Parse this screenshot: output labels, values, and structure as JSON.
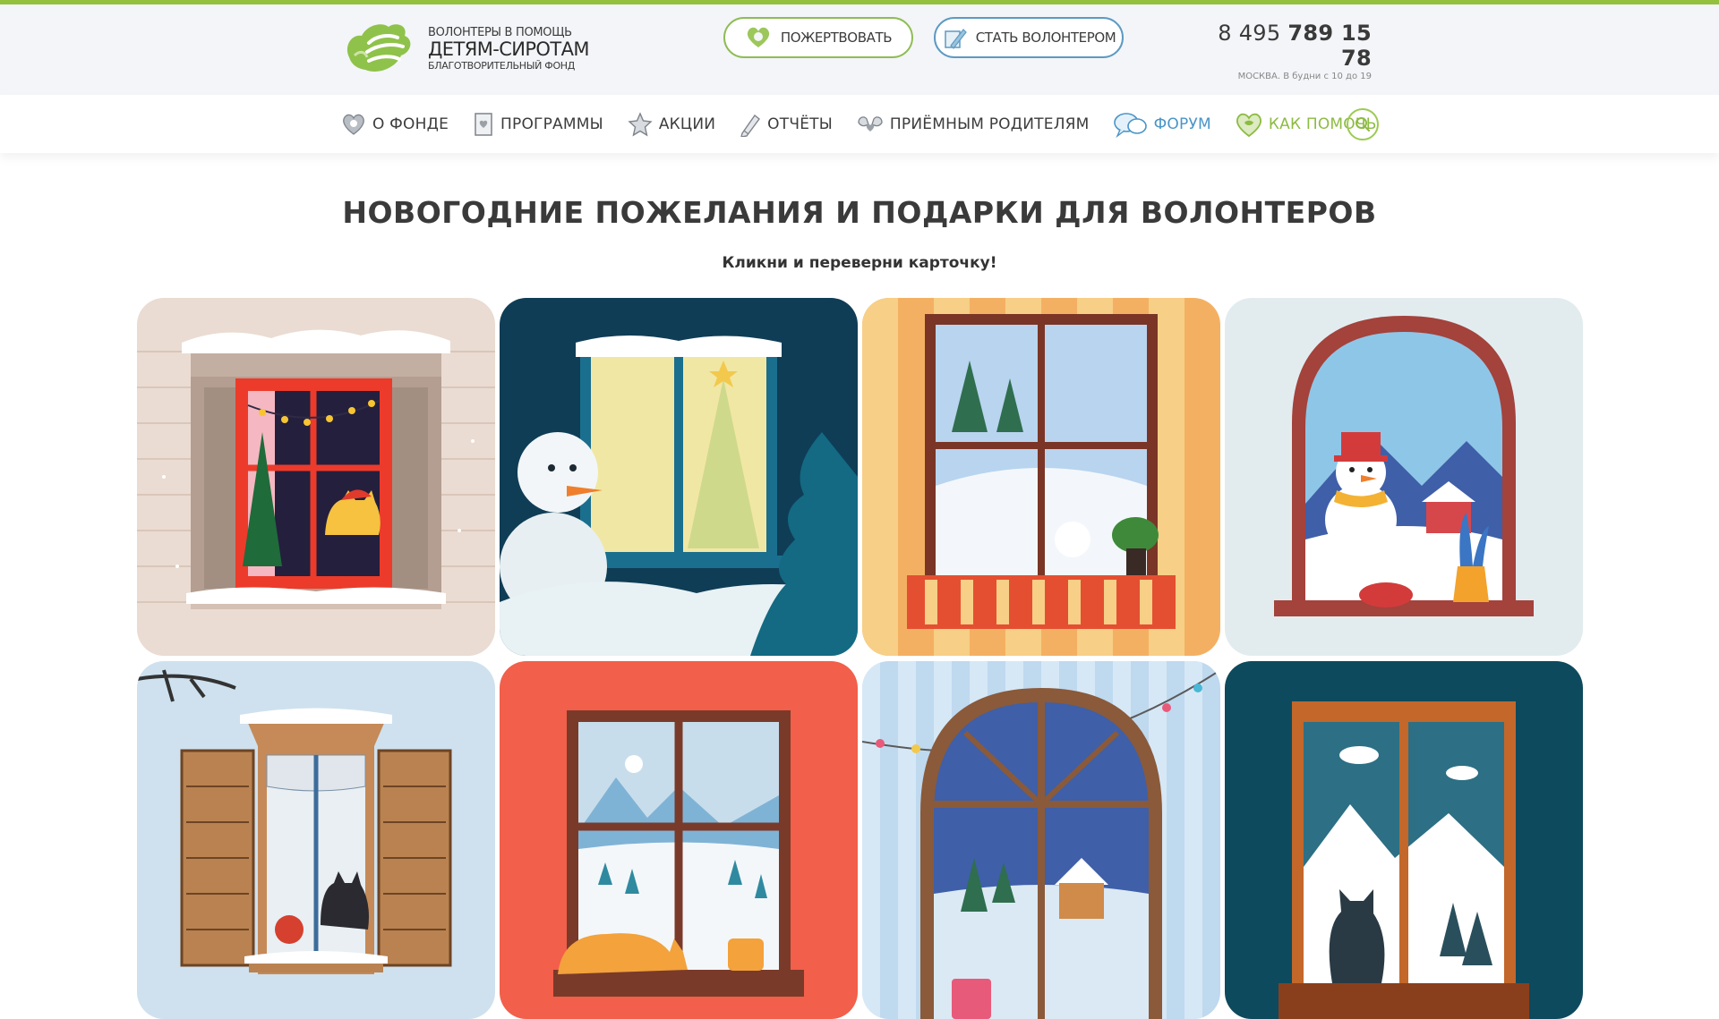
{
  "header": {
    "logo": {
      "line1": "ВОЛОНТЕРЫ В ПОМОЩЬ",
      "line2": "ДЕТЯМ-СИРОТАМ",
      "line3": "БЛАГОТВОРИТЕЛЬНЫЙ ФОНД"
    },
    "donate_label": "ПОЖЕРТВОВАТЬ",
    "volunteer_label": "СТАТЬ ВОЛОНТЕРОМ",
    "phone_prefix": "8 495 ",
    "phone_main": "789 15 78",
    "phone_hours": "МОСКВА. В будни с 10 до 19"
  },
  "nav": {
    "items": [
      {
        "label": "О ФОНДЕ",
        "icon": "heart-badge-icon"
      },
      {
        "label": "ПРОГРАММЫ",
        "icon": "document-icon"
      },
      {
        "label": "АКЦИИ",
        "icon": "star-icon"
      },
      {
        "label": "ОТЧЁТЫ",
        "icon": "pencil-icon"
      },
      {
        "label": "ПРИЁМНЫМ РОДИТЕЛЯМ",
        "icon": "hands-icon"
      },
      {
        "label": "ФОРУМ",
        "icon": "chat-bubbles-icon"
      },
      {
        "label": "КАК ПОМОЧЬ",
        "icon": "heart-icon"
      }
    ]
  },
  "main": {
    "title": "НОВОГОДНИЕ ПОЖЕЛАНИЯ И ПОДАРКИ ДЛЯ ВОЛОНТЕРОВ",
    "subtitle": "Кликни и переверни карточку!"
  },
  "cards": [
    {
      "name": "window-card-cat-red-window",
      "bg": "#eadcd2"
    },
    {
      "name": "window-card-snowman-night",
      "bg": "#0f3d56"
    },
    {
      "name": "window-card-striped-curtains",
      "bg": "#f4b062"
    },
    {
      "name": "window-card-arch-snowman",
      "bg": "#e2ecef"
    },
    {
      "name": "window-card-shutters-cat",
      "bg": "#cfe1ee"
    },
    {
      "name": "window-card-sleeping-cat",
      "bg": "#f25f4a"
    },
    {
      "name": "window-card-arch-garland",
      "bg": "#bfd9ef"
    },
    {
      "name": "window-card-cat-on-sill",
      "bg": "#0e4a5d"
    }
  ],
  "colors": {
    "accent_green": "#93c13d",
    "accent_blue": "#4a95c8",
    "header_bg": "#f3f5f8"
  }
}
